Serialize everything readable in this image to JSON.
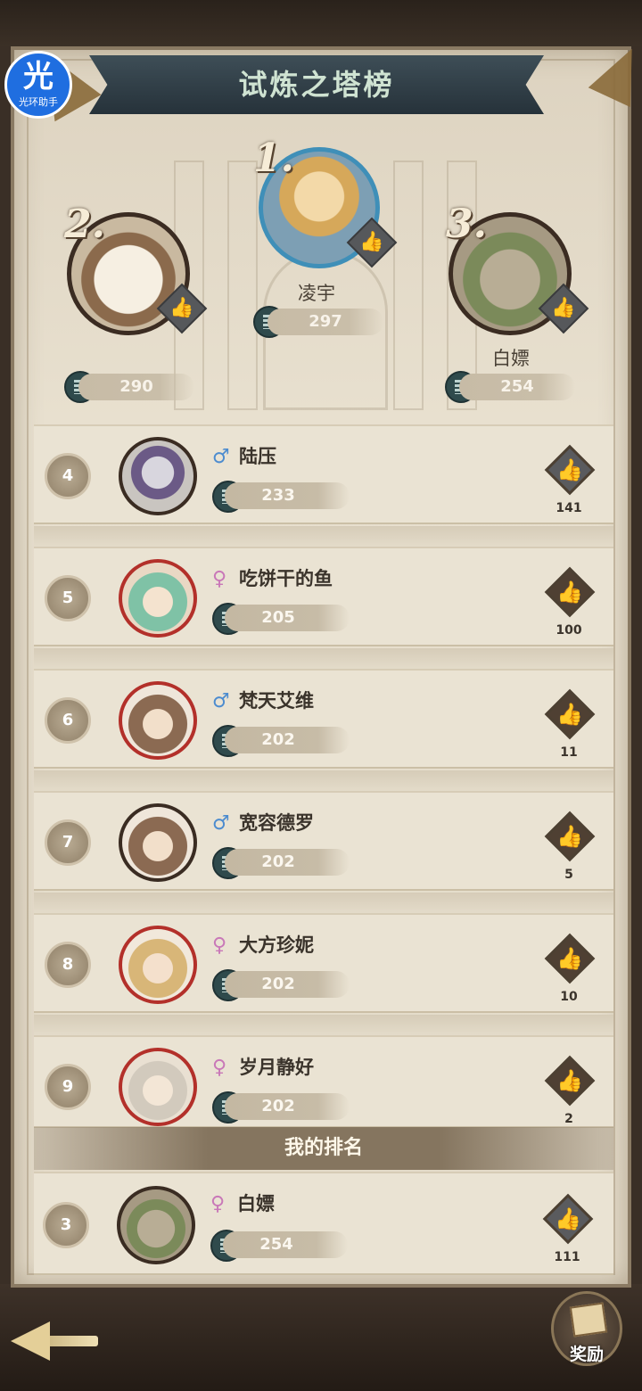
{
  "header": {
    "title": "试炼之塔榜",
    "logo_main": "光",
    "logo_sub": "光环助手"
  },
  "podium": [
    {
      "rank_label": "1.",
      "name": "凌宇",
      "score": "297",
      "avatar_icon": "blonde-hero-avatar",
      "frame_color": "#3f8fb8"
    },
    {
      "rank_label": "2.",
      "name": "",
      "score": "290",
      "avatar_icon": "cat-avatar",
      "frame_color": "#3b2c22"
    },
    {
      "rank_label": "3.",
      "name": "白嫖",
      "score": "254",
      "avatar_icon": "tree-golem-avatar",
      "frame_color": "#3b2c22"
    }
  ],
  "list": [
    {
      "rank": "4",
      "gender": "♂",
      "gender_type": "male",
      "name": "陆压",
      "score": "233",
      "likes": "141",
      "like_style": "gray",
      "avatar_icon": "dark-knight-avatar",
      "frame_color": "#3a2c22"
    },
    {
      "rank": "5",
      "gender": "♀",
      "gender_type": "female",
      "name": "吃饼干的鱼",
      "score": "205",
      "likes": "100",
      "like_style": "brown",
      "avatar_icon": "green-hair-girl-avatar",
      "frame_color": "#b3302a"
    },
    {
      "rank": "6",
      "gender": "♂",
      "gender_type": "male",
      "name": "梵天艾维",
      "score": "202",
      "likes": "11",
      "like_style": "brown",
      "avatar_icon": "brown-hair-boy-avatar",
      "frame_color": "#b3302a"
    },
    {
      "rank": "7",
      "gender": "♂",
      "gender_type": "male",
      "name": "宽容德罗",
      "score": "202",
      "likes": "5",
      "like_style": "brown",
      "avatar_icon": "brown-hair-boy-avatar",
      "frame_color": "#3a2c22"
    },
    {
      "rank": "8",
      "gender": "♀",
      "gender_type": "female",
      "name": "大方珍妮",
      "score": "202",
      "likes": "10",
      "like_style": "brown",
      "avatar_icon": "blonde-girl-avatar",
      "frame_color": "#b3302a"
    },
    {
      "rank": "9",
      "gender": "♀",
      "gender_type": "female",
      "name": "岁月静好",
      "score": "202",
      "likes": "2",
      "like_style": "brown",
      "avatar_icon": "white-hair-elf-avatar",
      "frame_color": "#b3302a"
    }
  ],
  "my_rank": {
    "header": "我的排名",
    "rank": "3",
    "gender": "♀",
    "gender_type": "female",
    "name": "白嫖",
    "score": "254",
    "likes": "111",
    "like_style": "gray",
    "avatar_icon": "tree-golem-avatar"
  },
  "footer": {
    "reward_label": "奖励"
  },
  "icons": {
    "thumb": "👍"
  }
}
